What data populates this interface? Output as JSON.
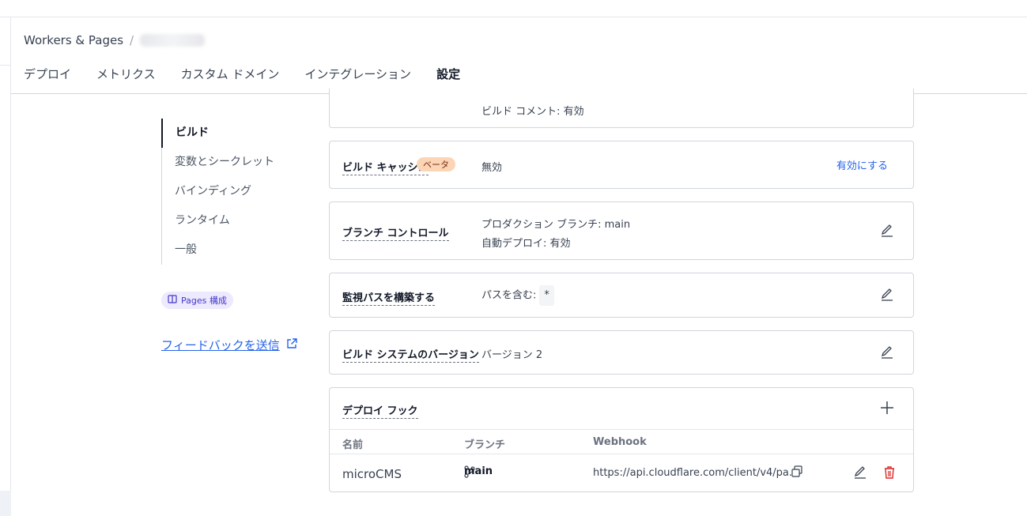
{
  "breadcrumb": {
    "root": "Workers & Pages",
    "separator": "/"
  },
  "tabs": [
    {
      "label": "デプロイ"
    },
    {
      "label": "メトリクス"
    },
    {
      "label": "カスタム ドメイン"
    },
    {
      "label": "インテグレーション"
    },
    {
      "label": "設定",
      "active": true
    }
  ],
  "subnav": {
    "items": [
      {
        "label": "ビルド",
        "active": true
      },
      {
        "label": "変数とシークレット"
      },
      {
        "label": "バインディング"
      },
      {
        "label": "ランタイム"
      },
      {
        "label": "一般"
      }
    ]
  },
  "pages_badge": {
    "icon": "book-icon",
    "label": "Pages 構成"
  },
  "feedback": {
    "label": "フィードバックを送信",
    "icon": "external-link-icon"
  },
  "cards": {
    "build_comment": {
      "value": "ビルド コメント: 有効"
    },
    "build_cache": {
      "label": "ビルド キャッシュ",
      "badge": "ベータ",
      "value": "無効",
      "action": "有効にする"
    },
    "branch_control": {
      "label": "ブランチ コントロール",
      "line1": "プロダクション ブランチ: main",
      "line2": "自動デプロイ: 有効"
    },
    "watch_paths": {
      "label": "監視パスを構築する",
      "value": "パスを含む:",
      "chip": "*"
    },
    "build_system": {
      "label": "ビルド システムのバージョン",
      "value": "バージョン 2"
    },
    "deploy_hooks": {
      "label": "デプロイ フック",
      "columns": [
        "名前",
        "ブランチ",
        "Webhook"
      ],
      "rows": [
        {
          "name": "microCMS",
          "branch": "main",
          "webhook": "https://api.cloudflare.com/client/v4/pa..."
        }
      ]
    }
  },
  "colors": {
    "accent": "#2563eb",
    "delete": "#dc2626",
    "beta_bg": "#fbd5b5",
    "badge_bg": "#ede9fe"
  }
}
